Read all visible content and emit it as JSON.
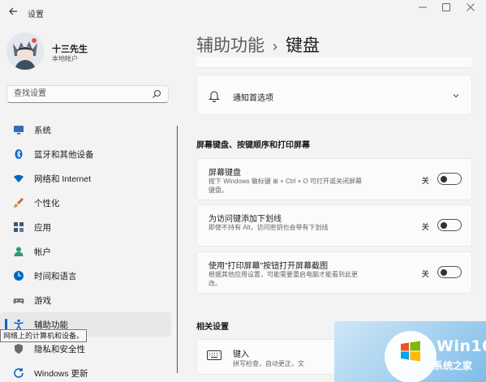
{
  "window": {
    "title": "设置",
    "back_icon": "back-arrow-icon",
    "controls": [
      "minimize-icon",
      "maximize-icon",
      "close-icon"
    ]
  },
  "profile": {
    "name": "十三先生",
    "account_type": "本地帐户"
  },
  "search": {
    "placeholder": "查找设置"
  },
  "nav": {
    "items": [
      {
        "label": "系统",
        "icon": "monitor-icon",
        "color": "#0067c0"
      },
      {
        "label": "蓝牙和其他设备",
        "icon": "bluetooth-icon",
        "color": "#0067c0"
      },
      {
        "label": "网络和 Internet",
        "icon": "wifi-icon",
        "color": "#0067c0"
      },
      {
        "label": "个性化",
        "icon": "brush-icon",
        "color": "#c46a2c"
      },
      {
        "label": "应用",
        "icon": "apps-icon",
        "color": "#3a5a78"
      },
      {
        "label": "帐户",
        "icon": "person-icon",
        "color": "#2e9b6e"
      },
      {
        "label": "时间和语言",
        "icon": "globe-clock-icon",
        "color": "#0067c0"
      },
      {
        "label": "游戏",
        "icon": "gamepad-icon",
        "color": "#777777"
      },
      {
        "label": "辅助功能",
        "icon": "accessibility-icon",
        "color": "#0067c0",
        "active": true
      },
      {
        "label": "隐私和安全性",
        "icon": "shield-icon",
        "color": "#555555"
      },
      {
        "label": "Windows 更新",
        "icon": "update-icon",
        "color": "#0067c0"
      }
    ],
    "tooltip": "网络上的计算机和设备。"
  },
  "breadcrumb": {
    "parent": "辅助功能",
    "separator": "›",
    "current": "键盘"
  },
  "notifications_card": {
    "label": "通知首选项"
  },
  "section_keyboard": {
    "title": "屏幕键盘、按键顺序和打印屏幕"
  },
  "settings": [
    {
      "title": "屏幕键盘",
      "desc": "按下 Windows 徽标键 ⊞ + Ctrl + O 可打开或关闭屏幕键盘。",
      "state": "关",
      "on": false
    },
    {
      "title": "为访问键添加下划线",
      "desc": "即使不持有 Alt，访问密钥也会带有下划线",
      "state": "关",
      "on": false
    },
    {
      "title": "使用\"打印屏幕\"按钮打开屏幕截图",
      "desc": "根据其他应用设置，可能需要重启电脑才能看到此更改。",
      "state": "关",
      "on": false
    }
  ],
  "section_related": {
    "title": "相关设置"
  },
  "related": {
    "title": "键入",
    "desc": "拼写检查，自动更正，文"
  },
  "watermark": {
    "brand_win": "Win",
    "brand_ten": "10",
    "tagline": "系统之家"
  },
  "colors": {
    "accent": "#0067c0",
    "background": "#f3f3f3",
    "card": "#fbfbfb"
  }
}
